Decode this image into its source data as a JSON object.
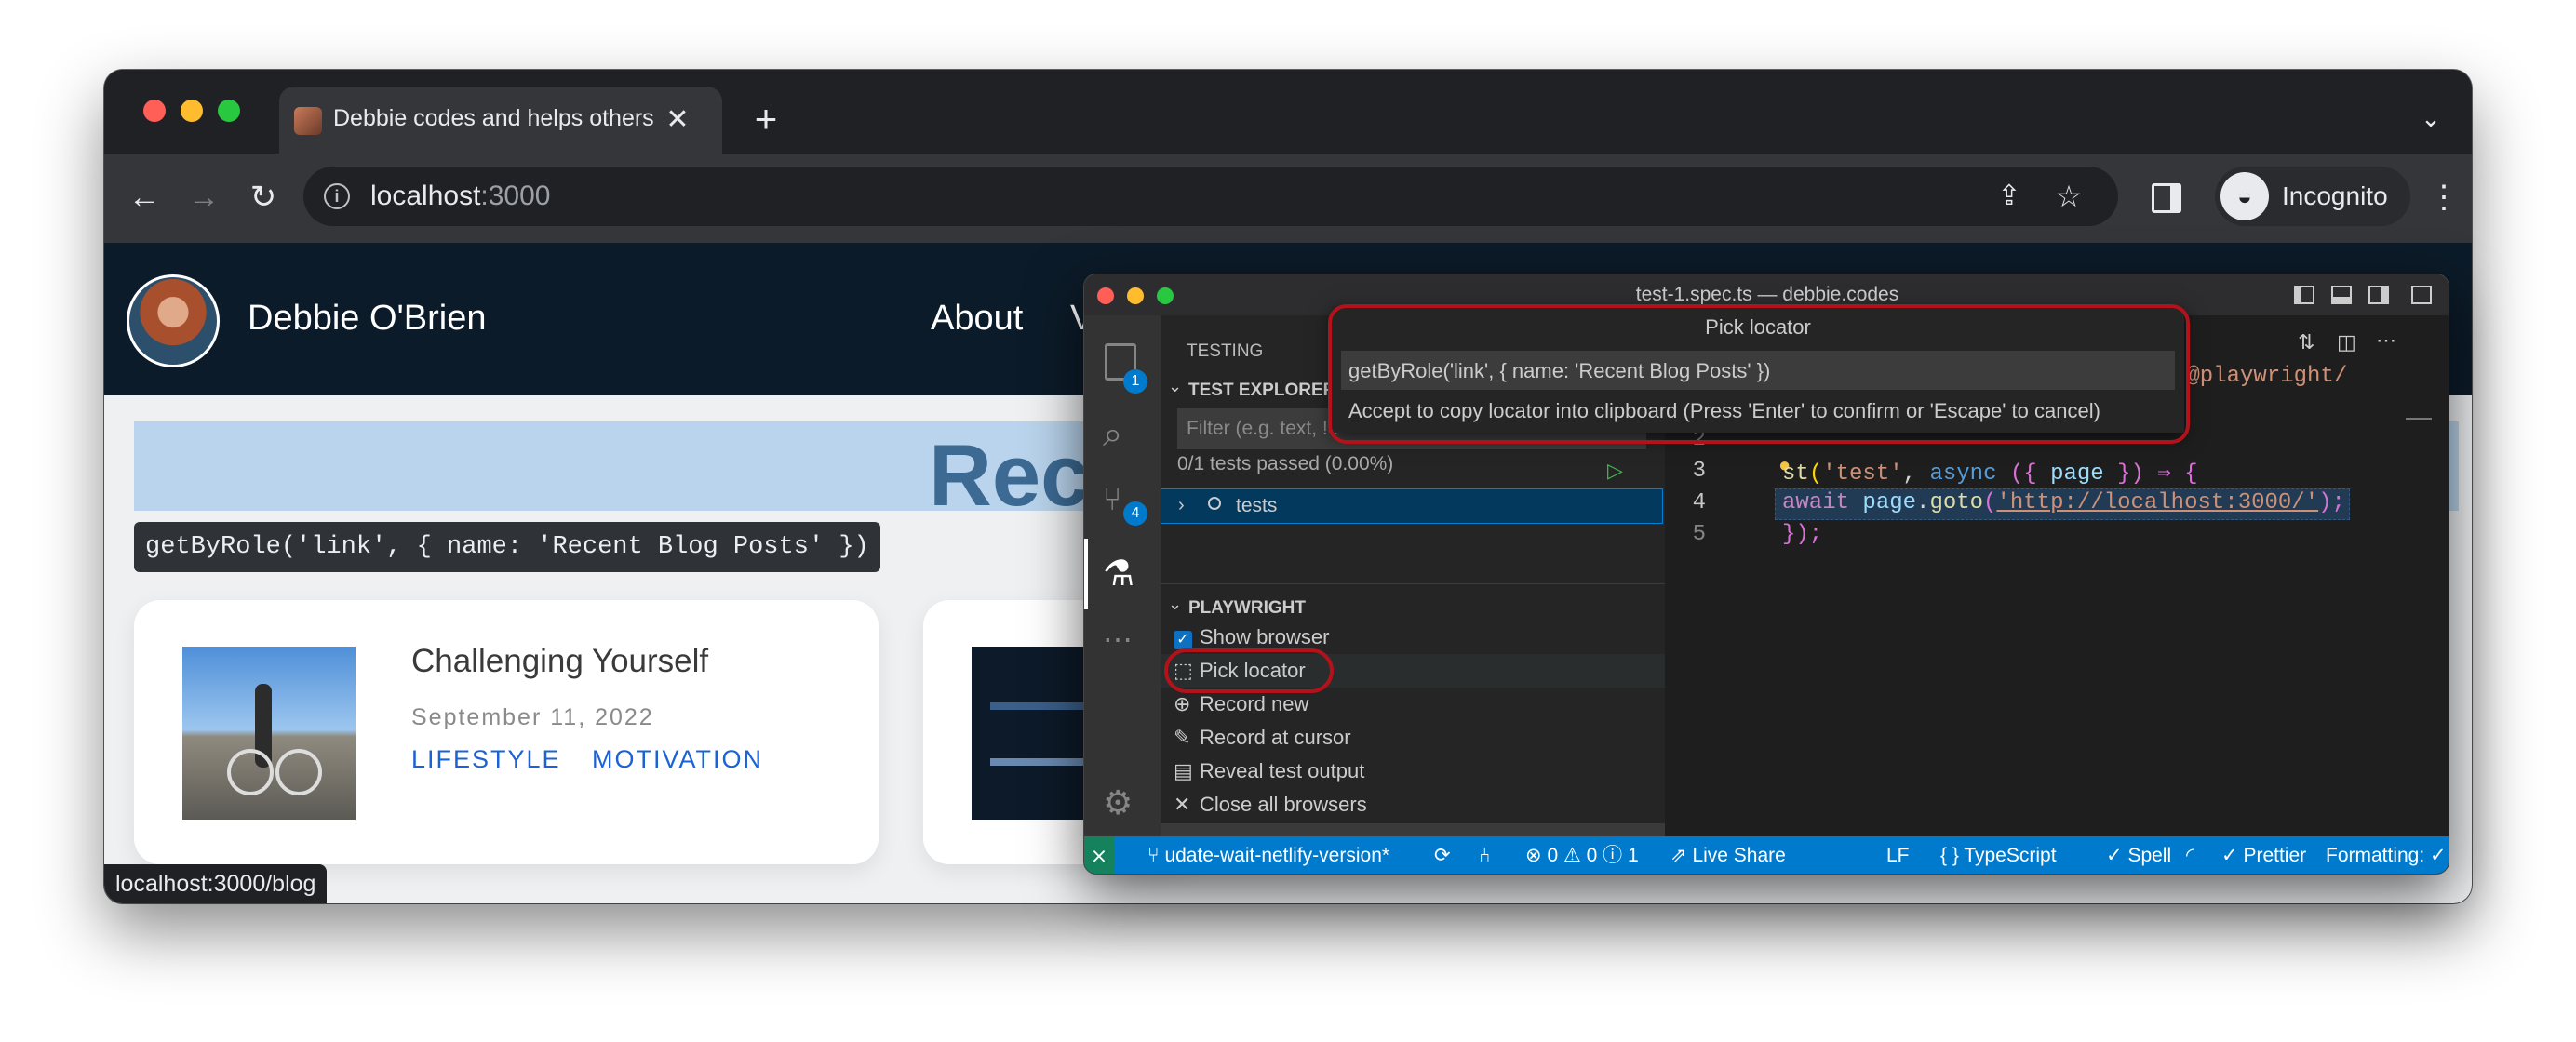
{
  "browser": {
    "tab_title": "Debbie codes and helps others",
    "new_tab": "+",
    "url_host": "localhost",
    "url_port": ":3000",
    "profile_label": "Incognito",
    "status_url": "localhost:3000/blog"
  },
  "site": {
    "name": "Debbie O'Brien",
    "nav": [
      "About",
      "V"
    ],
    "heading_partial": "Rec",
    "locator_tooltip": "getByRole('link', { name: 'Recent Blog Posts' })",
    "posts": [
      {
        "title": "Challenging Yourself",
        "date": "September 11, 2022",
        "tags": [
          "LIFESTYLE",
          "MOTIVATION"
        ]
      }
    ]
  },
  "vscode": {
    "window_title": "test-1.spec.ts — debbie.codes",
    "activity_badges": {
      "explorer": "1",
      "source_control": "4"
    },
    "sidebar": {
      "header": "TESTING",
      "explorer_title": "TEST EXPLORER",
      "filter_placeholder": "Filter (e.g. text, !e",
      "tests_passed": "0/1 tests passed (0.00%)",
      "tree_item": "tests",
      "playwright_title": "PLAYWRIGHT",
      "show_browser": "Show browser",
      "actions": [
        "Pick locator",
        "Record new",
        "Record at cursor",
        "Reveal test output",
        "Close all browsers"
      ]
    },
    "quick_pick": {
      "title": "Pick locator",
      "value": "getByRole('link', { name: 'Recent Blog Posts' })",
      "hint": "Accept to copy locator into clipboard (Press 'Enter' to confirm or 'Escape' to cancel)"
    },
    "editor": {
      "import_tail": "'@playwright/",
      "line_numbers": [
        "2",
        "3",
        "4",
        "5"
      ],
      "line3": {
        "p1": "st",
        "p2": "(",
        "p3": "'test'",
        "p4": ", ",
        "p5": "async",
        "p6": " ({ ",
        "p7": "page",
        "p8": " }) ⇒ {"
      },
      "line4": {
        "p1": "await",
        "p2": " page",
        "p3": ".",
        "p4": "goto",
        "p5": "(",
        "p6": "'http://localhost:3000/'",
        "p7": ");"
      },
      "line5": "});"
    },
    "statusbar": {
      "remote": "⨯",
      "branch": "udate-wait-netlify-version*",
      "errors": "0",
      "warnings": "0",
      "info": "1",
      "live_share": "Live Share",
      "eol": "LF",
      "language": "TypeScript",
      "spell": "Spell",
      "prettier": "Prettier",
      "formatting": "Formatting: ✓"
    }
  },
  "colors": {
    "vscode_blue": "#007acc",
    "highlight_red": "#b3121a",
    "link_blue": "#1a62d6",
    "site_navy": "#0c1b29"
  }
}
